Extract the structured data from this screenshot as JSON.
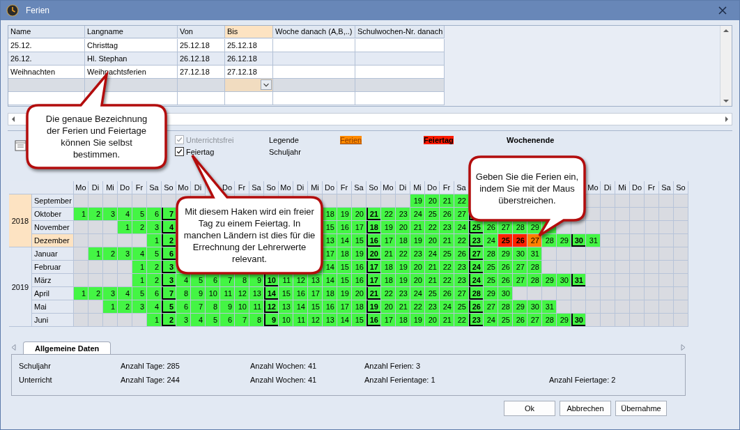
{
  "window": {
    "title": "Ferien"
  },
  "holidays_table": {
    "columns": [
      {
        "label": "Name",
        "selected": false
      },
      {
        "label": "Langname",
        "selected": false
      },
      {
        "label": "Von",
        "selected": false
      },
      {
        "label": "Bis",
        "selected": true
      },
      {
        "label": "Woche danach (A,B,..)",
        "selected": false
      },
      {
        "label": "Schulwochen-Nr. danach",
        "selected": false
      }
    ],
    "rows": [
      {
        "kind": "entry",
        "cells": [
          "25.12.",
          "Christtag",
          "25.12.18",
          "25.12.18"
        ]
      },
      {
        "kind": "entry",
        "cells": [
          "26.12.",
          "Hl. Stephan",
          "26.12.18",
          "26.12.18"
        ]
      },
      {
        "kind": "entry",
        "cells": [
          "Weihnachten",
          "Weihnachtsferien",
          "27.12.18",
          "27.12.18"
        ]
      },
      {
        "kind": "new"
      },
      {
        "kind": "blank"
      }
    ]
  },
  "options": [
    {
      "label": "Unterrichtsfrei",
      "checked": true,
      "disabled": true
    },
    {
      "label": "Feiertag",
      "checked": true,
      "disabled": false
    }
  ],
  "legend": {
    "title": "Legende",
    "subtitle": "Schuljahr",
    "items": [
      {
        "label": "Ferien",
        "kind": "ferien"
      },
      {
        "label": "Feiertag",
        "kind": "feiertag"
      },
      {
        "label": "Wochenende",
        "kind": "wochenende"
      }
    ]
  },
  "calendar": {
    "weekdays": [
      {
        "label": "Mo"
      },
      {
        "label": "Di"
      },
      {
        "label": "Mi"
      },
      {
        "label": "Do"
      },
      {
        "label": "Fr"
      },
      {
        "label": "Sa"
      },
      {
        "label": "So"
      },
      {
        "label": "Mo"
      },
      {
        "label": "Di"
      },
      {
        "kind": "covered"
      },
      {
        "label": "Do"
      },
      {
        "label": "Fr"
      },
      {
        "label": "Sa"
      },
      {
        "label": "So"
      },
      {
        "label": "Mo"
      },
      {
        "label": "Di"
      },
      {
        "label": "Mi"
      },
      {
        "label": "Do"
      },
      {
        "label": "Fr"
      },
      {
        "label": "Sa"
      },
      {
        "label": "So"
      },
      {
        "label": "Mo"
      },
      {
        "label": "Di"
      },
      {
        "label": "Mi"
      },
      {
        "label": "Do"
      },
      {
        "label": "Fr"
      },
      {
        "label": "Sa"
      },
      {
        "kind": "covered"
      },
      {
        "kind": "covered"
      },
      {
        "kind": "covered"
      },
      {
        "kind": "covered"
      },
      {
        "kind": "covered"
      },
      {
        "kind": "covered"
      },
      {
        "kind": "covered"
      },
      {
        "kind": "covered"
      },
      {
        "label": "Mo"
      },
      {
        "label": "Di"
      },
      {
        "label": "Mi"
      },
      {
        "label": "Do"
      },
      {
        "label": "Fr"
      },
      {
        "label": "Sa"
      },
      {
        "label": "So"
      }
    ],
    "years": [
      {
        "year": "2018",
        "selected": true,
        "months": [
          {
            "name": "September",
            "selected": false,
            "cells": [
              {
                "kind": "off"
              },
              {
                "kind": "off"
              },
              {
                "kind": "off"
              },
              {
                "kind": "off"
              },
              {
                "kind": "off"
              },
              {
                "kind": "off"
              },
              {
                "kind": "off"
              },
              {
                "kind": "off"
              },
              {
                "kind": "off"
              },
              {
                "kind": "off"
              },
              {
                "kind": "off"
              },
              {
                "kind": "off"
              },
              {
                "kind": "off"
              },
              {
                "kind": "off"
              },
              {
                "kind": "off"
              },
              {
                "kind": "off"
              },
              {
                "kind": "off"
              },
              {
                "kind": "off"
              },
              {
                "kind": "off"
              },
              {
                "kind": "off"
              },
              {
                "kind": "off"
              },
              {
                "kind": "off"
              },
              {
                "kind": "off"
              },
              {
                "kind": "day",
                "day": "19"
              },
              {
                "kind": "day",
                "day": "20"
              },
              {
                "kind": "day",
                "day": "21"
              },
              {
                "kind": "day",
                "day": "22"
              },
              {
                "kind": "covered"
              },
              {
                "kind": "covered"
              },
              {
                "kind": "covered"
              },
              {
                "kind": "covered"
              },
              {
                "kind": "day"
              },
              {
                "kind": "day"
              },
              {
                "kind": "day"
              },
              {
                "kind": "sunday"
              },
              {
                "kind": "off"
              },
              {
                "kind": "off"
              },
              {
                "kind": "off"
              },
              {
                "kind": "off"
              },
              {
                "kind": "off"
              },
              {
                "kind": "off"
              },
              {
                "kind": "off"
              }
            ]
          },
          {
            "name": "Oktober",
            "selected": false,
            "cells": [
              {
                "kind": "day",
                "day": "1"
              },
              {
                "kind": "day",
                "day": "2"
              },
              {
                "kind": "day",
                "day": "3"
              },
              {
                "kind": "day",
                "day": "4"
              },
              {
                "kind": "day",
                "day": "5"
              },
              {
                "kind": "day",
                "day": "6"
              },
              {
                "kind": "sunday",
                "day": "7"
              },
              {
                "kind": "day"
              },
              {
                "kind": "day"
              },
              {
                "kind": "day"
              },
              {
                "kind": "day"
              },
              {
                "kind": "day"
              },
              {
                "kind": "day"
              },
              {
                "kind": "sunday"
              },
              {
                "kind": "day"
              },
              {
                "kind": "day"
              },
              {
                "kind": "day"
              },
              {
                "kind": "day",
                "day": "18"
              },
              {
                "kind": "day",
                "day": "19"
              },
              {
                "kind": "day",
                "day": "20"
              },
              {
                "kind": "sunday",
                "day": "21"
              },
              {
                "kind": "day",
                "day": "22"
              },
              {
                "kind": "day",
                "day": "23"
              },
              {
                "kind": "day",
                "day": "24"
              },
              {
                "kind": "day",
                "day": "25"
              },
              {
                "kind": "day",
                "day": "26"
              },
              {
                "kind": "day",
                "day": "27"
              },
              {
                "kind": "sunday"
              },
              {
                "kind": "day"
              },
              {
                "kind": "day"
              },
              {
                "kind": "day"
              },
              {
                "kind": "off"
              },
              {
                "kind": "off"
              },
              {
                "kind": "off"
              },
              {
                "kind": "off"
              },
              {
                "kind": "off"
              },
              {
                "kind": "off"
              },
              {
                "kind": "off"
              },
              {
                "kind": "off"
              },
              {
                "kind": "off"
              },
              {
                "kind": "off"
              },
              {
                "kind": "off"
              }
            ]
          },
          {
            "name": "November",
            "selected": false,
            "cells": [
              {
                "kind": "off"
              },
              {
                "kind": "off"
              },
              {
                "kind": "off"
              },
              {
                "kind": "day",
                "day": "1"
              },
              {
                "kind": "day",
                "day": "2"
              },
              {
                "kind": "day",
                "day": "3"
              },
              {
                "kind": "sunday",
                "day": "4"
              },
              {
                "kind": "day"
              },
              {
                "kind": "day"
              },
              {
                "kind": "day"
              },
              {
                "kind": "day"
              },
              {
                "kind": "day"
              },
              {
                "kind": "day"
              },
              {
                "kind": "sunday"
              },
              {
                "kind": "day"
              },
              {
                "kind": "day"
              },
              {
                "kind": "day"
              },
              {
                "kind": "day",
                "day": "15"
              },
              {
                "kind": "day",
                "day": "16"
              },
              {
                "kind": "day",
                "day": "17"
              },
              {
                "kind": "sunday",
                "day": "18"
              },
              {
                "kind": "day",
                "day": "19"
              },
              {
                "kind": "day",
                "day": "20"
              },
              {
                "kind": "day",
                "day": "21"
              },
              {
                "kind": "day",
                "day": "22"
              },
              {
                "kind": "day",
                "day": "23"
              },
              {
                "kind": "day",
                "day": "24"
              },
              {
                "kind": "sunday",
                "day": "25"
              },
              {
                "kind": "day",
                "day": "26"
              },
              {
                "kind": "day",
                "day": "27"
              },
              {
                "kind": "day",
                "day": "28"
              },
              {
                "kind": "day",
                "day": "29"
              },
              {
                "kind": "day"
              },
              {
                "kind": "off"
              },
              {
                "kind": "off"
              },
              {
                "kind": "off"
              },
              {
                "kind": "off"
              },
              {
                "kind": "off"
              },
              {
                "kind": "off"
              },
              {
                "kind": "off"
              },
              {
                "kind": "off"
              },
              {
                "kind": "off"
              }
            ]
          },
          {
            "name": "Dezember",
            "selected": true,
            "cells": [
              {
                "kind": "off"
              },
              {
                "kind": "off"
              },
              {
                "kind": "off"
              },
              {
                "kind": "off"
              },
              {
                "kind": "off"
              },
              {
                "kind": "day",
                "day": "1"
              },
              {
                "kind": "sunday",
                "day": "2"
              },
              {
                "kind": "day"
              },
              {
                "kind": "day"
              },
              {
                "kind": "day"
              },
              {
                "kind": "day"
              },
              {
                "kind": "day"
              },
              {
                "kind": "day"
              },
              {
                "kind": "sunday"
              },
              {
                "kind": "day"
              },
              {
                "kind": "day"
              },
              {
                "kind": "day"
              },
              {
                "kind": "day",
                "day": "13"
              },
              {
                "kind": "day",
                "day": "14"
              },
              {
                "kind": "day",
                "day": "15"
              },
              {
                "kind": "sunday",
                "day": "16"
              },
              {
                "kind": "day",
                "day": "17"
              },
              {
                "kind": "day",
                "day": "18"
              },
              {
                "kind": "day",
                "day": "19"
              },
              {
                "kind": "day",
                "day": "20"
              },
              {
                "kind": "day",
                "day": "21"
              },
              {
                "kind": "day",
                "day": "22"
              },
              {
                "kind": "sunday",
                "day": "23"
              },
              {
                "kind": "day",
                "day": "24"
              },
              {
                "kind": "feiertag",
                "day": "25"
              },
              {
                "kind": "feiertag",
                "day": "26"
              },
              {
                "kind": "ferien",
                "day": "27"
              },
              {
                "kind": "day",
                "day": "28"
              },
              {
                "kind": "day",
                "day": "29"
              },
              {
                "kind": "sunday",
                "day": "30"
              },
              {
                "kind": "day",
                "day": "31"
              },
              {
                "kind": "off"
              },
              {
                "kind": "off"
              },
              {
                "kind": "off"
              },
              {
                "kind": "off"
              },
              {
                "kind": "off"
              },
              {
                "kind": "off"
              }
            ]
          }
        ]
      },
      {
        "year": "2019",
        "selected": false,
        "months": [
          {
            "name": "Januar",
            "selected": false,
            "cells": [
              {
                "kind": "off"
              },
              {
                "kind": "day",
                "day": "1"
              },
              {
                "kind": "day",
                "day": "2"
              },
              {
                "kind": "day",
                "day": "3"
              },
              {
                "kind": "day",
                "day": "4"
              },
              {
                "kind": "day",
                "day": "5"
              },
              {
                "kind": "sunday",
                "day": "6"
              },
              {
                "kind": "day"
              },
              {
                "kind": "day"
              },
              {
                "kind": "day"
              },
              {
                "kind": "day"
              },
              {
                "kind": "day"
              },
              {
                "kind": "day"
              },
              {
                "kind": "sunday"
              },
              {
                "kind": "day"
              },
              {
                "kind": "day"
              },
              {
                "kind": "day"
              },
              {
                "kind": "day",
                "day": "17"
              },
              {
                "kind": "day",
                "day": "18"
              },
              {
                "kind": "day",
                "day": "19"
              },
              {
                "kind": "sunday",
                "day": "20"
              },
              {
                "kind": "day",
                "day": "21"
              },
              {
                "kind": "day",
                "day": "22"
              },
              {
                "kind": "day",
                "day": "23"
              },
              {
                "kind": "day",
                "day": "24"
              },
              {
                "kind": "day",
                "day": "25"
              },
              {
                "kind": "day",
                "day": "26"
              },
              {
                "kind": "sunday",
                "day": "27"
              },
              {
                "kind": "day",
                "day": "28"
              },
              {
                "kind": "day",
                "day": "29"
              },
              {
                "kind": "day",
                "day": "30"
              },
              {
                "kind": "day",
                "day": "31"
              },
              {
                "kind": "off"
              },
              {
                "kind": "off"
              },
              {
                "kind": "off"
              },
              {
                "kind": "off"
              },
              {
                "kind": "off"
              },
              {
                "kind": "off"
              },
              {
                "kind": "off"
              },
              {
                "kind": "off"
              },
              {
                "kind": "off"
              },
              {
                "kind": "off"
              }
            ]
          },
          {
            "name": "Februar",
            "selected": false,
            "cells": [
              {
                "kind": "off"
              },
              {
                "kind": "off"
              },
              {
                "kind": "off"
              },
              {
                "kind": "off"
              },
              {
                "kind": "day",
                "day": "1"
              },
              {
                "kind": "day",
                "day": "2"
              },
              {
                "kind": "sunday",
                "day": "3"
              },
              {
                "kind": "day"
              },
              {
                "kind": "day"
              },
              {
                "kind": "day"
              },
              {
                "kind": "day"
              },
              {
                "kind": "day"
              },
              {
                "kind": "day"
              },
              {
                "kind": "sunday"
              },
              {
                "kind": "day"
              },
              {
                "kind": "day"
              },
              {
                "kind": "day"
              },
              {
                "kind": "day",
                "day": "14"
              },
              {
                "kind": "day",
                "day": "15"
              },
              {
                "kind": "day",
                "day": "16"
              },
              {
                "kind": "sunday",
                "day": "17"
              },
              {
                "kind": "day",
                "day": "18"
              },
              {
                "kind": "day",
                "day": "19"
              },
              {
                "kind": "day",
                "day": "20"
              },
              {
                "kind": "day",
                "day": "21"
              },
              {
                "kind": "day",
                "day": "22"
              },
              {
                "kind": "day",
                "day": "23"
              },
              {
                "kind": "sunday",
                "day": "24"
              },
              {
                "kind": "day",
                "day": "25"
              },
              {
                "kind": "day",
                "day": "26"
              },
              {
                "kind": "day",
                "day": "27"
              },
              {
                "kind": "day",
                "day": "28"
              },
              {
                "kind": "off"
              },
              {
                "kind": "off"
              },
              {
                "kind": "off"
              },
              {
                "kind": "off"
              },
              {
                "kind": "off"
              },
              {
                "kind": "off"
              },
              {
                "kind": "off"
              },
              {
                "kind": "off"
              },
              {
                "kind": "off"
              },
              {
                "kind": "off"
              }
            ]
          },
          {
            "name": "März",
            "selected": false,
            "cells": [
              {
                "kind": "off"
              },
              {
                "kind": "off"
              },
              {
                "kind": "off"
              },
              {
                "kind": "off"
              },
              {
                "kind": "day",
                "day": "1"
              },
              {
                "kind": "day",
                "day": "2"
              },
              {
                "kind": "sunday",
                "day": "3"
              },
              {
                "kind": "day",
                "day": "4"
              },
              {
                "kind": "day",
                "day": "5"
              },
              {
                "kind": "day",
                "day": "6"
              },
              {
                "kind": "day",
                "day": "7"
              },
              {
                "kind": "day",
                "day": "8"
              },
              {
                "kind": "day",
                "day": "9"
              },
              {
                "kind": "sunday",
                "day": "10"
              },
              {
                "kind": "day",
                "day": "11"
              },
              {
                "kind": "day",
                "day": "12"
              },
              {
                "kind": "day",
                "day": "13"
              },
              {
                "kind": "day",
                "day": "14"
              },
              {
                "kind": "day",
                "day": "15"
              },
              {
                "kind": "day",
                "day": "16"
              },
              {
                "kind": "sunday",
                "day": "17"
              },
              {
                "kind": "day",
                "day": "18"
              },
              {
                "kind": "day",
                "day": "19"
              },
              {
                "kind": "day",
                "day": "20"
              },
              {
                "kind": "day",
                "day": "21"
              },
              {
                "kind": "day",
                "day": "22"
              },
              {
                "kind": "day",
                "day": "23"
              },
              {
                "kind": "sunday",
                "day": "24"
              },
              {
                "kind": "day",
                "day": "25"
              },
              {
                "kind": "day",
                "day": "26"
              },
              {
                "kind": "day",
                "day": "27"
              },
              {
                "kind": "day",
                "day": "28"
              },
              {
                "kind": "day",
                "day": "29"
              },
              {
                "kind": "day",
                "day": "30"
              },
              {
                "kind": "sunday",
                "day": "31"
              },
              {
                "kind": "off"
              },
              {
                "kind": "off"
              },
              {
                "kind": "off"
              },
              {
                "kind": "off"
              },
              {
                "kind": "off"
              },
              {
                "kind": "off"
              },
              {
                "kind": "off"
              }
            ]
          },
          {
            "name": "April",
            "selected": false,
            "cells": [
              {
                "kind": "day",
                "day": "1"
              },
              {
                "kind": "day",
                "day": "2"
              },
              {
                "kind": "day",
                "day": "3"
              },
              {
                "kind": "day",
                "day": "4"
              },
              {
                "kind": "day",
                "day": "5"
              },
              {
                "kind": "day",
                "day": "6"
              },
              {
                "kind": "sunday",
                "day": "7"
              },
              {
                "kind": "day",
                "day": "8"
              },
              {
                "kind": "day",
                "day": "9"
              },
              {
                "kind": "day",
                "day": "10"
              },
              {
                "kind": "day",
                "day": "11"
              },
              {
                "kind": "day",
                "day": "12"
              },
              {
                "kind": "day",
                "day": "13"
              },
              {
                "kind": "sunday",
                "day": "14"
              },
              {
                "kind": "day",
                "day": "15"
              },
              {
                "kind": "day",
                "day": "16"
              },
              {
                "kind": "day",
                "day": "17"
              },
              {
                "kind": "day",
                "day": "18"
              },
              {
                "kind": "day",
                "day": "19"
              },
              {
                "kind": "day",
                "day": "20"
              },
              {
                "kind": "sunday",
                "day": "21"
              },
              {
                "kind": "day",
                "day": "22"
              },
              {
                "kind": "day",
                "day": "23"
              },
              {
                "kind": "day",
                "day": "24"
              },
              {
                "kind": "day",
                "day": "25"
              },
              {
                "kind": "day",
                "day": "26"
              },
              {
                "kind": "day",
                "day": "27"
              },
              {
                "kind": "sunday",
                "day": "28"
              },
              {
                "kind": "day",
                "day": "29"
              },
              {
                "kind": "day",
                "day": "30"
              },
              {
                "kind": "off"
              },
              {
                "kind": "off"
              },
              {
                "kind": "off"
              },
              {
                "kind": "off"
              },
              {
                "kind": "off"
              },
              {
                "kind": "off"
              },
              {
                "kind": "off"
              },
              {
                "kind": "off"
              },
              {
                "kind": "off"
              },
              {
                "kind": "off"
              },
              {
                "kind": "off"
              },
              {
                "kind": "off"
              }
            ]
          },
          {
            "name": "Mai",
            "selected": false,
            "cells": [
              {
                "kind": "off"
              },
              {
                "kind": "off"
              },
              {
                "kind": "day",
                "day": "1"
              },
              {
                "kind": "day",
                "day": "2"
              },
              {
                "kind": "day",
                "day": "3"
              },
              {
                "kind": "day",
                "day": "4"
              },
              {
                "kind": "sunday",
                "day": "5"
              },
              {
                "kind": "day",
                "day": "6"
              },
              {
                "kind": "day",
                "day": "7"
              },
              {
                "kind": "day",
                "day": "8"
              },
              {
                "kind": "day",
                "day": "9"
              },
              {
                "kind": "day",
                "day": "10"
              },
              {
                "kind": "day",
                "day": "11"
              },
              {
                "kind": "sunday",
                "day": "12"
              },
              {
                "kind": "day",
                "day": "13"
              },
              {
                "kind": "day",
                "day": "14"
              },
              {
                "kind": "day",
                "day": "15"
              },
              {
                "kind": "day",
                "day": "16"
              },
              {
                "kind": "day",
                "day": "17"
              },
              {
                "kind": "day",
                "day": "18"
              },
              {
                "kind": "sunday",
                "day": "19"
              },
              {
                "kind": "day",
                "day": "20"
              },
              {
                "kind": "day",
                "day": "21"
              },
              {
                "kind": "day",
                "day": "22"
              },
              {
                "kind": "day",
                "day": "23"
              },
              {
                "kind": "day",
                "day": "24"
              },
              {
                "kind": "day",
                "day": "25"
              },
              {
                "kind": "sunday",
                "day": "26"
              },
              {
                "kind": "day",
                "day": "27"
              },
              {
                "kind": "day",
                "day": "28"
              },
              {
                "kind": "day",
                "day": "29"
              },
              {
                "kind": "day",
                "day": "30"
              },
              {
                "kind": "day",
                "day": "31"
              },
              {
                "kind": "off"
              },
              {
                "kind": "off"
              },
              {
                "kind": "off"
              },
              {
                "kind": "off"
              },
              {
                "kind": "off"
              },
              {
                "kind": "off"
              },
              {
                "kind": "off"
              },
              {
                "kind": "off"
              },
              {
                "kind": "off"
              }
            ]
          },
          {
            "name": "Juni",
            "selected": false,
            "cells": [
              {
                "kind": "off"
              },
              {
                "kind": "off"
              },
              {
                "kind": "off"
              },
              {
                "kind": "off"
              },
              {
                "kind": "off"
              },
              {
                "kind": "day",
                "day": "1"
              },
              {
                "kind": "sunday",
                "day": "2"
              },
              {
                "kind": "day",
                "day": "3"
              },
              {
                "kind": "day",
                "day": "4"
              },
              {
                "kind": "day",
                "day": "5"
              },
              {
                "kind": "day",
                "day": "6"
              },
              {
                "kind": "day",
                "day": "7"
              },
              {
                "kind": "day",
                "day": "8"
              },
              {
                "kind": "sunday",
                "day": "9"
              },
              {
                "kind": "day",
                "day": "10"
              },
              {
                "kind": "day",
                "day": "11"
              },
              {
                "kind": "day",
                "day": "12"
              },
              {
                "kind": "day",
                "day": "13"
              },
              {
                "kind": "day",
                "day": "14"
              },
              {
                "kind": "day",
                "day": "15"
              },
              {
                "kind": "sunday",
                "day": "16"
              },
              {
                "kind": "day",
                "day": "17"
              },
              {
                "kind": "day",
                "day": "18"
              },
              {
                "kind": "day",
                "day": "19"
              },
              {
                "kind": "day",
                "day": "20"
              },
              {
                "kind": "day",
                "day": "21"
              },
              {
                "kind": "day",
                "day": "22"
              },
              {
                "kind": "sunday",
                "day": "23"
              },
              {
                "kind": "day",
                "day": "24"
              },
              {
                "kind": "day",
                "day": "25"
              },
              {
                "kind": "day",
                "day": "26"
              },
              {
                "kind": "day",
                "day": "27"
              },
              {
                "kind": "day",
                "day": "28"
              },
              {
                "kind": "day",
                "day": "29"
              },
              {
                "kind": "sunday",
                "day": "30"
              },
              {
                "kind": "off"
              },
              {
                "kind": "off"
              },
              {
                "kind": "off"
              },
              {
                "kind": "off"
              },
              {
                "kind": "off"
              },
              {
                "kind": "off"
              },
              {
                "kind": "off"
              }
            ]
          }
        ]
      }
    ]
  },
  "tabs": [
    {
      "label": "Allgemeine Daten",
      "selected": true
    }
  ],
  "stats": [
    {
      "label": "Schuljahr",
      "values": [
        "Anzahl Tage: 285",
        "Anzahl Wochen: 41",
        "Anzahl Ferien: 3"
      ]
    },
    {
      "label": "Unterricht",
      "values": [
        "Anzahl Tage: 244",
        "Anzahl Wochen: 41",
        "Anzahl Ferientage: 1",
        "Anzahl Feiertage: 2"
      ]
    }
  ],
  "buttons": [
    "Ok",
    "Abbrechen",
    "Übernahme"
  ],
  "callouts": [
    {
      "text": "Die genaue Bezeichnung der Ferien und Feiertage können Sie selbst bestimmen."
    },
    {
      "text": "Mit diesem Haken wird ein freier Tag zu einem Feiertag. In manchen Ländern ist dies für die Errechnung der Lehrerwerte relevant."
    },
    {
      "text": "Geben Sie die Ferien ein, indem Sie mit der Maus überstreichen."
    }
  ]
}
